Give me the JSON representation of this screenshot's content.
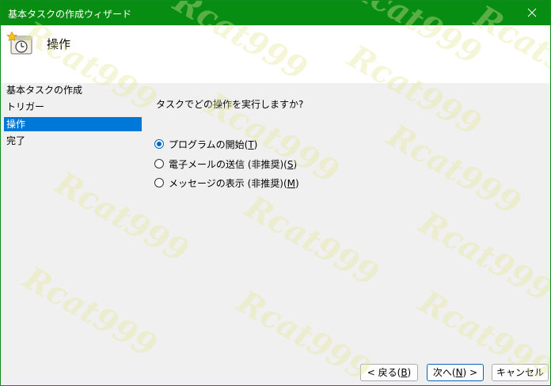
{
  "window": {
    "title": "基本タスクの作成ウィザード"
  },
  "header": {
    "title": "操作",
    "icon": "task-clock-icon"
  },
  "steps": [
    {
      "label": "基本タスクの作成",
      "selected": false
    },
    {
      "label": "トリガー",
      "selected": false
    },
    {
      "label": "操作",
      "selected": true
    },
    {
      "label": "完了",
      "selected": false
    }
  ],
  "main": {
    "question": "タスクでどの操作を実行しますか?",
    "options": [
      {
        "text": "プログラムの開始(",
        "key": "T",
        "suffix": ")",
        "checked": true
      },
      {
        "text": "電子メールの送信 (非推奨)(",
        "key": "S",
        "suffix": ")",
        "checked": false
      },
      {
        "text": "メッセージの表示 (非推奨)(",
        "key": "M",
        "suffix": ")",
        "checked": false
      }
    ]
  },
  "buttons": {
    "back": {
      "pre": "< 戻る(",
      "key": "B",
      "post": ")"
    },
    "next": {
      "pre": "次へ(",
      "key": "N",
      "post": ") >"
    },
    "cancel": "キャンセル"
  },
  "watermark": "Rcat999",
  "colors": {
    "titlebar": "#078d12",
    "selection": "#0078d7",
    "radio_accent": "#0067c0"
  }
}
